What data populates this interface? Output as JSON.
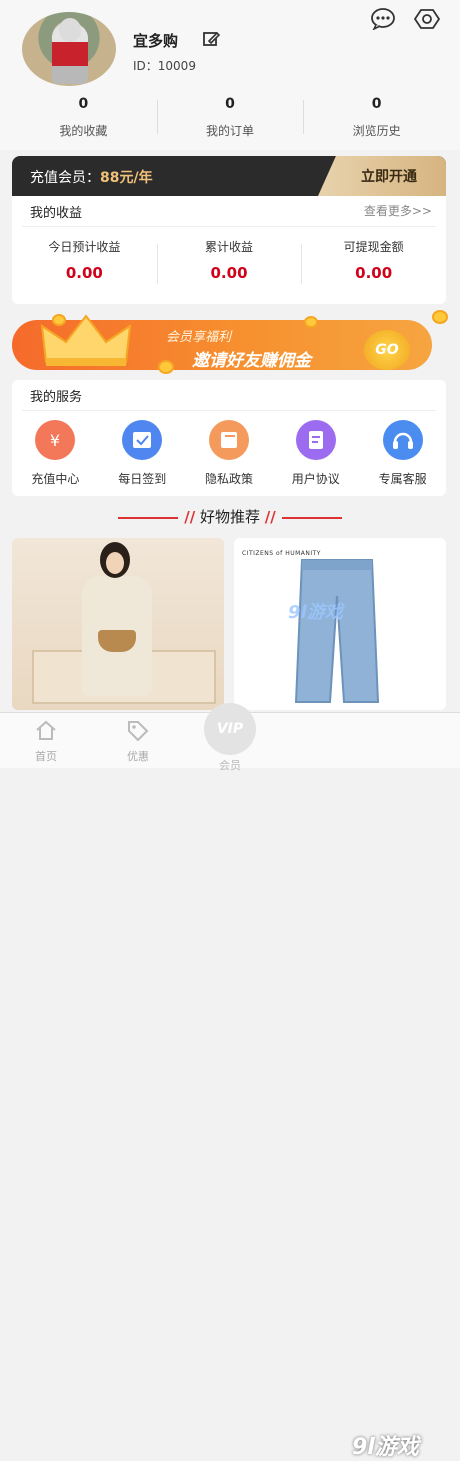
{
  "profile": {
    "username": "宜多购",
    "id_text": "ID：10009"
  },
  "stats": [
    {
      "value": "0",
      "label": "我的收藏"
    },
    {
      "value": "0",
      "label": "我的订单"
    },
    {
      "value": "0",
      "label": "浏览历史"
    }
  ],
  "vip": {
    "label": "充值会员：",
    "price": "88元/年",
    "button": "立即开通"
  },
  "earnings": {
    "title": "我的收益",
    "more": "查看更多>>",
    "items": [
      {
        "label": "今日预计收益",
        "value": "0.00"
      },
      {
        "label": "累计收益",
        "value": "0.00"
      },
      {
        "label": "可提现金额",
        "value": "0.00"
      }
    ]
  },
  "banner": {
    "line1": "会员享福利",
    "line2": "邀请好友赚佣金",
    "go": "GO"
  },
  "services": {
    "title": "我的服务",
    "items": [
      {
        "label": "充值中心",
        "icon": "yen-icon",
        "color": "#f3785a"
      },
      {
        "label": "每日签到",
        "icon": "calendar-check-icon",
        "color": "#4f86ef"
      },
      {
        "label": "隐私政策",
        "icon": "book-icon",
        "color": "#f49a5c"
      },
      {
        "label": "用户协议",
        "icon": "document-icon",
        "color": "#9b6cf0"
      },
      {
        "label": "专属客服",
        "icon": "headset-icon",
        "color": "#4a8cf0"
      }
    ]
  },
  "recommend": {
    "title": "好物推荐"
  },
  "products": [
    {
      "image": "woman-coat-photo"
    },
    {
      "image": "jeans-photo",
      "brand": "CITIZENS of HUMANITY"
    }
  ],
  "tabbar": {
    "items": [
      {
        "label": "首页",
        "icon": "home-icon"
      },
      {
        "label": "优惠",
        "icon": "tag-icon"
      },
      {
        "label": "会员",
        "icon": "vip-icon"
      }
    ],
    "vip_badge": "VIP"
  },
  "watermark": {
    "text": "9l游戏",
    "small": "9l游戏"
  }
}
